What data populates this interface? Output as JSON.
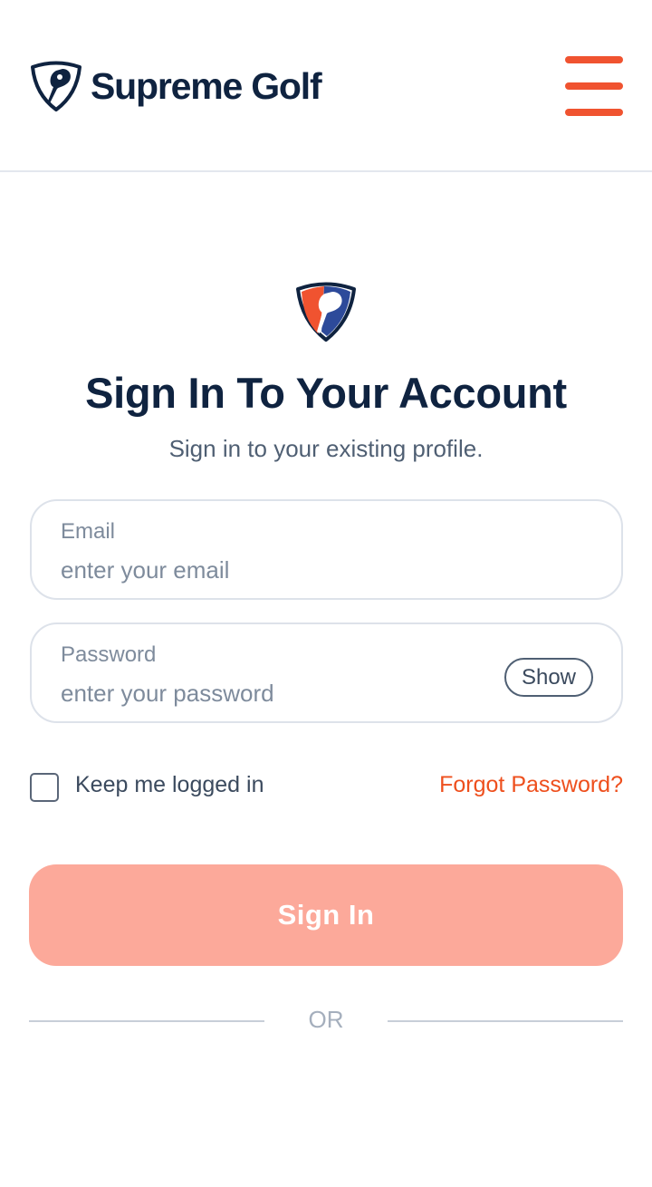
{
  "header": {
    "brand_name": "Supreme Golf",
    "menu_icon": "hamburger-menu-icon"
  },
  "signin": {
    "logo_icon": "supreme-golf-shield-logo",
    "title": "Sign In To Your Account",
    "subtitle": "Sign in to your existing profile."
  },
  "form": {
    "email": {
      "label": "Email",
      "value": "",
      "placeholder": "enter your email"
    },
    "password": {
      "label": "Password",
      "value": "",
      "placeholder": "enter your password",
      "show_label": "Show"
    },
    "keep_logged_in": {
      "label": "Keep me logged in",
      "checked": false
    },
    "forgot_password": "Forgot Password?",
    "submit_label": "Sign In"
  },
  "divider": {
    "text": "OR"
  },
  "colors": {
    "brand_navy": "#0f2340",
    "accent_orange": "#f05330",
    "link_orange": "#ee4f1d",
    "button_disabled": "#fca99a",
    "logo_blue": "#2d4a9a"
  }
}
